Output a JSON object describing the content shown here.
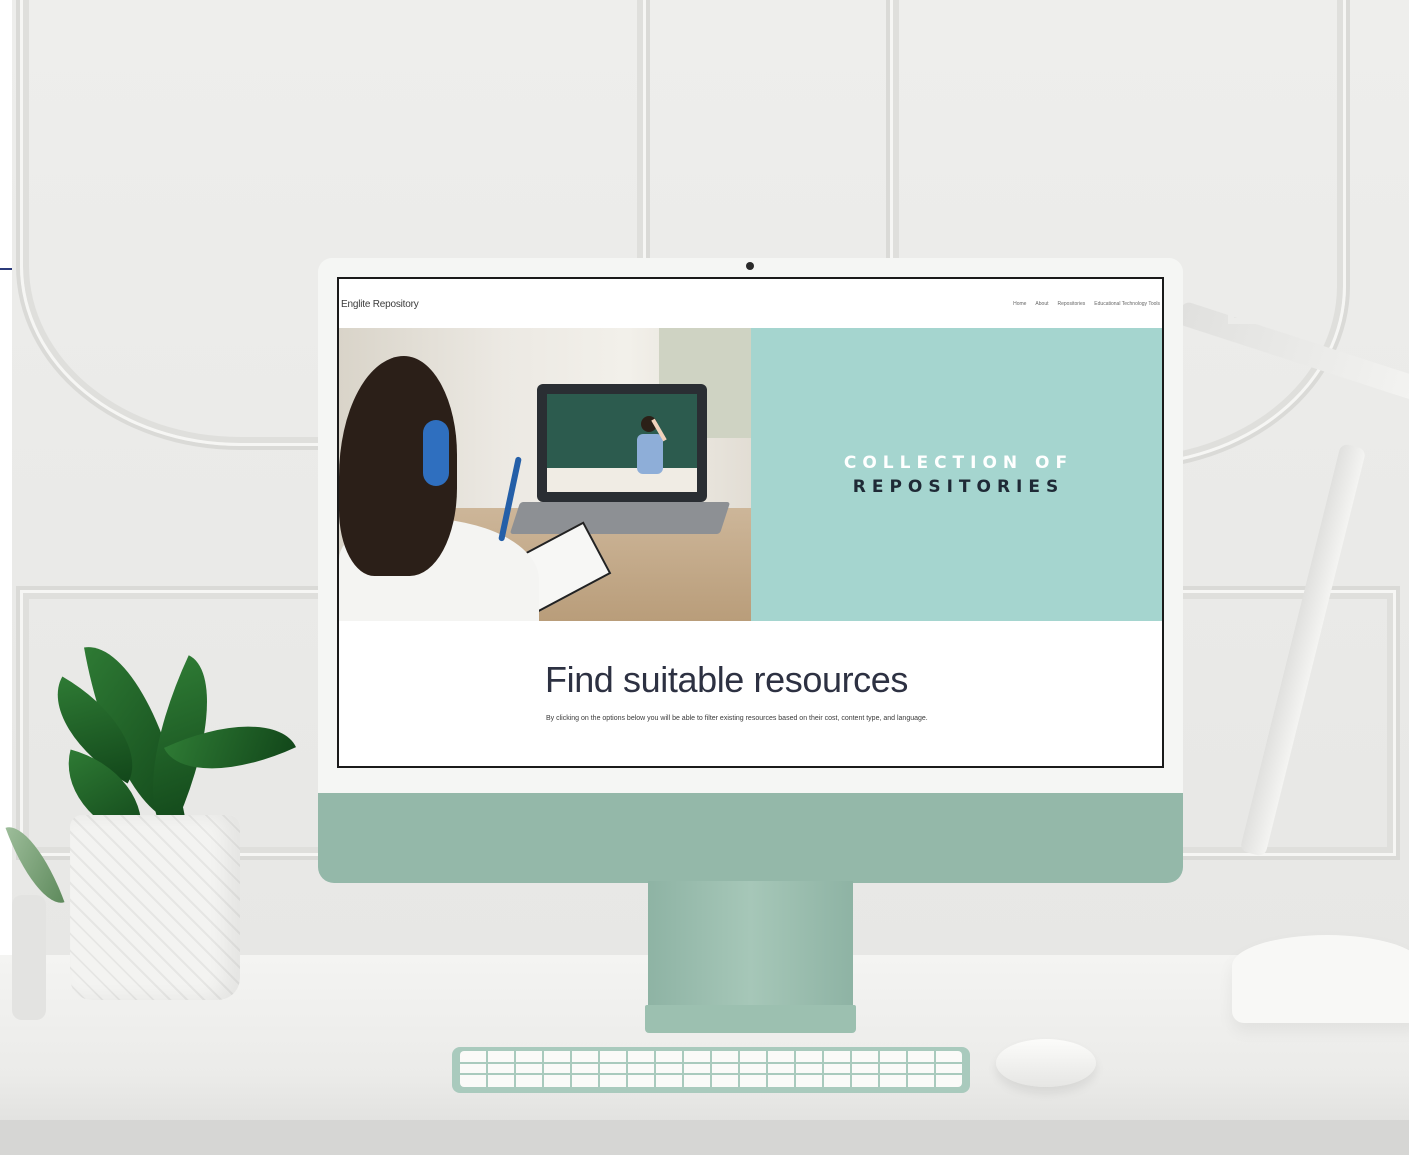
{
  "site": {
    "logo": "Englite Repository",
    "nav": [
      "Home",
      "About",
      "Repositories",
      "Educational Technology Tools"
    ]
  },
  "hero": {
    "title_line1": "COLLECTION OF",
    "title_line2": "REPOSITORIES",
    "teal_color": "#a5d5cf"
  },
  "content": {
    "heading": "Find suitable resources",
    "description": "By clicking on the options below you will be able to filter existing resources based on their cost, content type, and language."
  },
  "device": {
    "monitor_color": "#94b8a9"
  }
}
